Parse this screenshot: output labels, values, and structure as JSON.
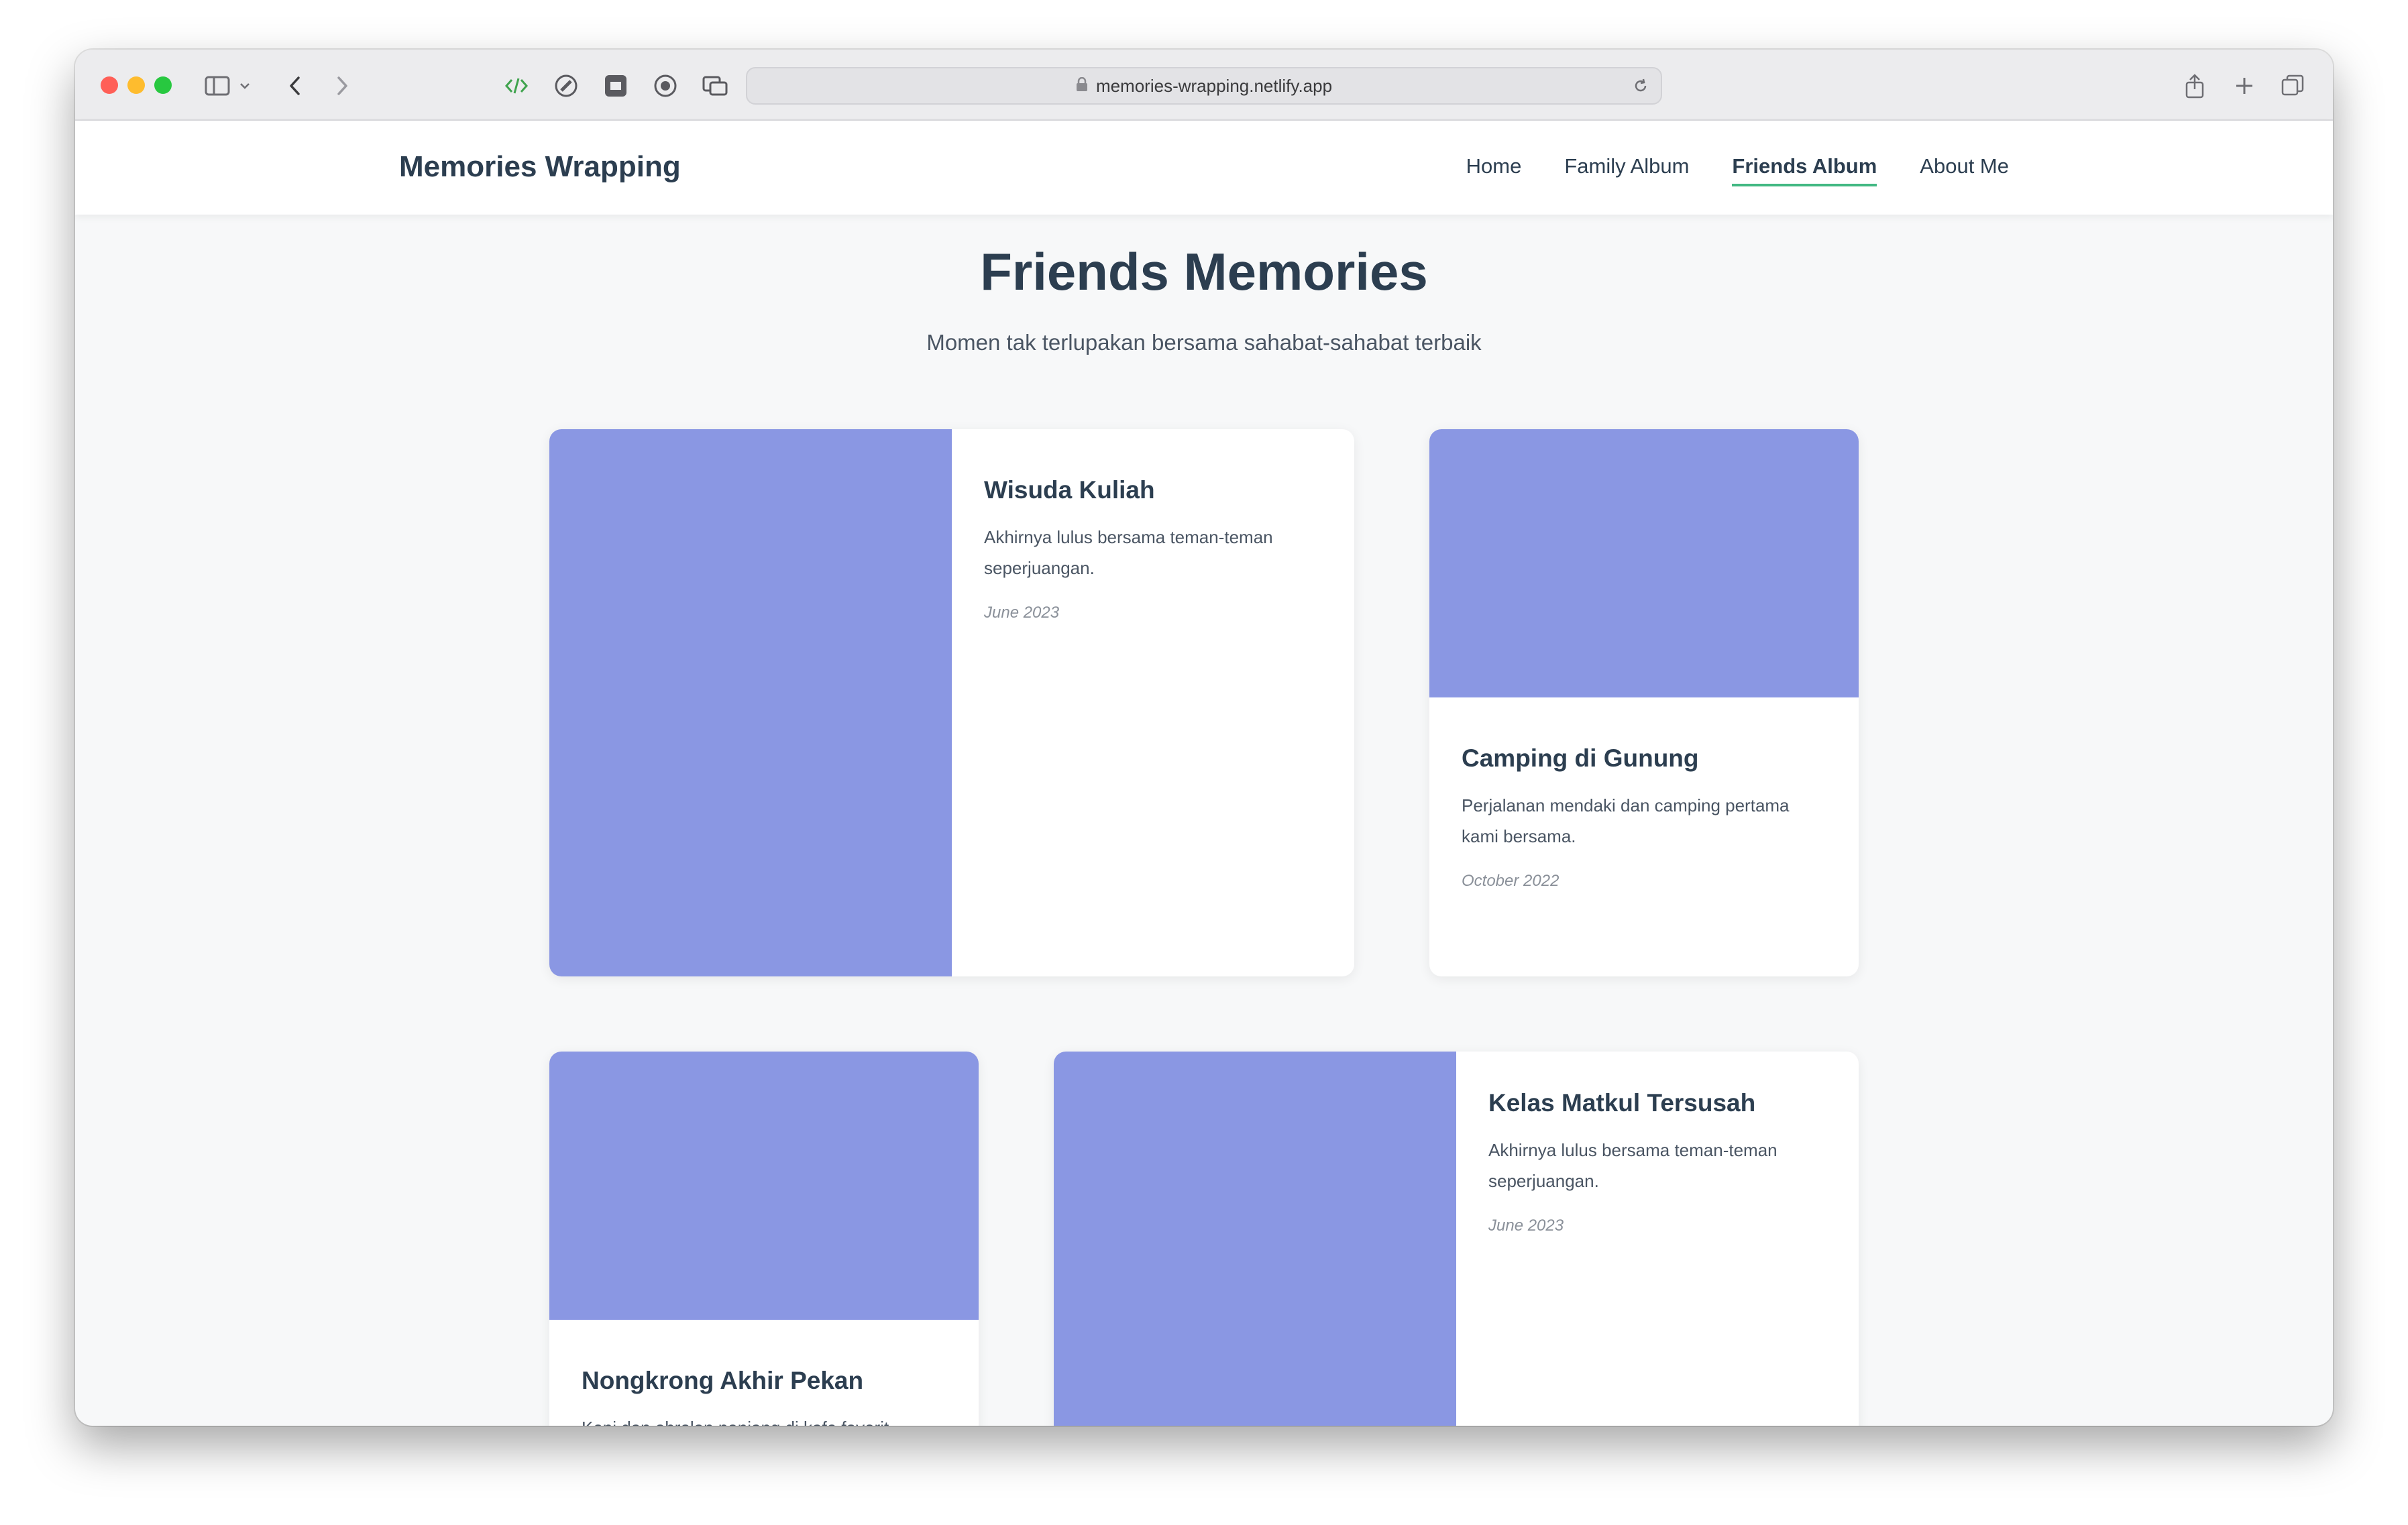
{
  "browser": {
    "url": "memories-wrapping.netlify.app"
  },
  "site": {
    "brand": "Memories Wrapping",
    "nav": [
      {
        "label": "Home",
        "active": false
      },
      {
        "label": "Family Album",
        "active": false
      },
      {
        "label": "Friends Album",
        "active": true
      },
      {
        "label": "About Me",
        "active": false
      }
    ],
    "accent_color": "#42b883",
    "image_placeholder_color": "#8a97e3"
  },
  "page": {
    "title": "Friends Memories",
    "subtitle": "Momen tak terlupakan bersama sahabat-sahabat terbaik"
  },
  "cards": [
    {
      "title": "Wisuda Kuliah",
      "description": "Akhirnya lulus bersama teman-teman seperjuangan.",
      "date": "June 2023"
    },
    {
      "title": "Camping di Gunung",
      "description": "Perjalanan mendaki dan camping pertama kami bersama.",
      "date": "October 2022"
    },
    {
      "title": "Nongkrong Akhir Pekan",
      "description": "Kopi dan obrolan panjang di kafe favorit."
    },
    {
      "title": "Kelas Matkul Tersusah",
      "description": "Akhirnya lulus bersama teman-teman seperjuangan.",
      "date": "June 2023"
    }
  ]
}
